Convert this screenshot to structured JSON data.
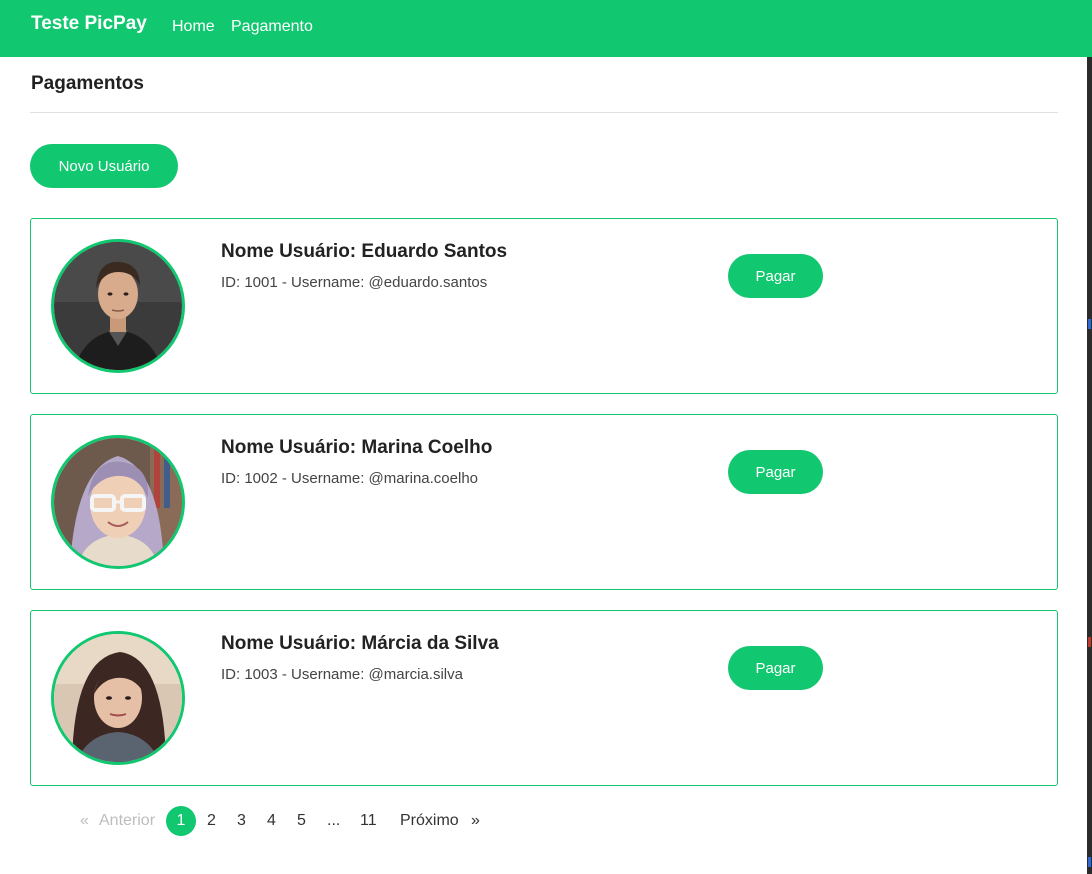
{
  "navbar": {
    "brand": "Teste PicPay",
    "links": [
      "Home",
      "Pagamento"
    ],
    "color": "#11c76f"
  },
  "page": {
    "title": "Pagamentos",
    "new_user_button": "Novo Usuário"
  },
  "users": [
    {
      "name": "Nome Usuário: Eduardo Santos",
      "meta": "ID: 1001 - Username: @eduardo.santos",
      "pay_label": "Pagar"
    },
    {
      "name": "Nome Usuário: Marina Coelho",
      "meta": "ID: 1002 - Username: @marina.coelho",
      "pay_label": "Pagar"
    },
    {
      "name": "Nome Usuário: Márcia da Silva",
      "meta": "ID: 1003 - Username: @marcia.silva",
      "pay_label": "Pagar"
    }
  ],
  "pagination": {
    "prev_symbol": "«",
    "prev_label": "Anterior",
    "pages": [
      "1",
      "2",
      "3",
      "4",
      "5",
      "...",
      "11"
    ],
    "active_page": "1",
    "next_label": "Próximo",
    "next_symbol": "»"
  }
}
